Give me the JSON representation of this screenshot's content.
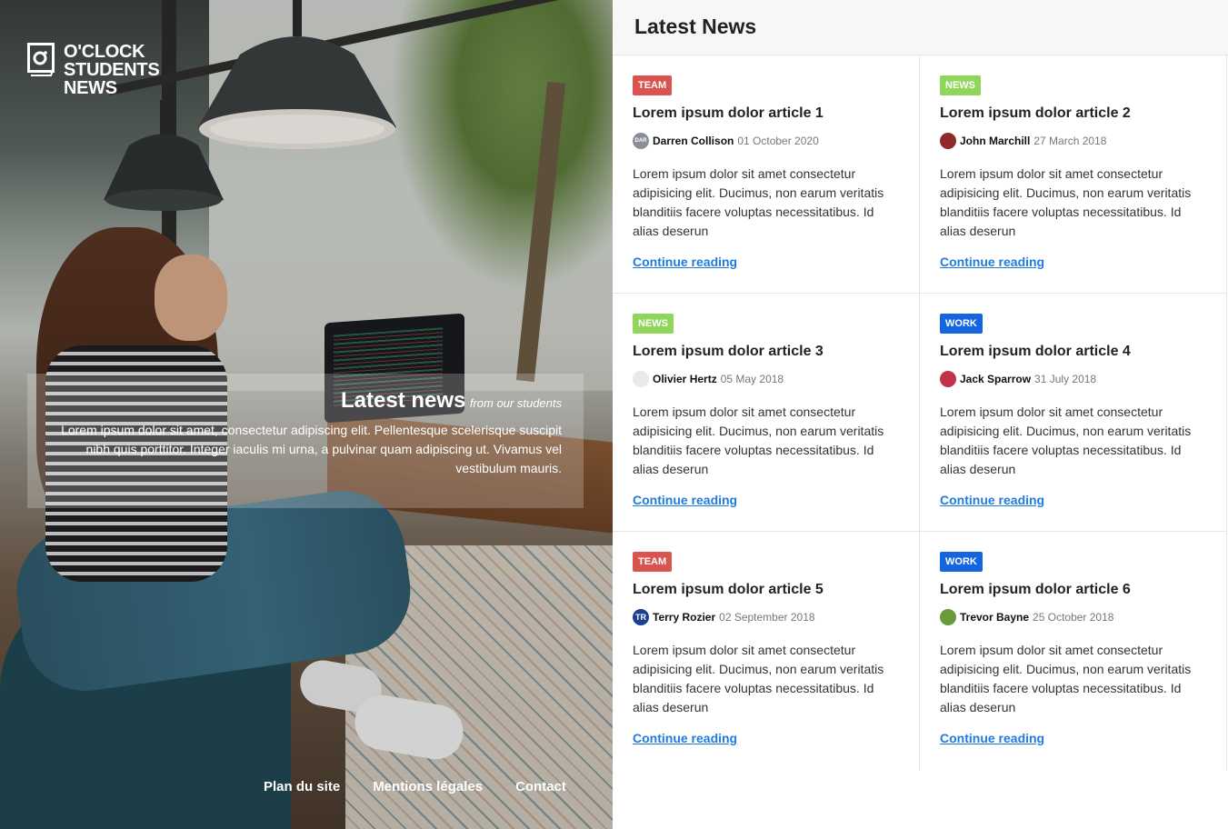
{
  "brand": {
    "lines": [
      "O'CLOCK",
      "STUDENTS",
      "NEWS"
    ]
  },
  "intro": {
    "title": "Latest news",
    "subtitle": "from our students",
    "text": "Lorem ipsum dolor sit amet, consectetur adipiscing elit. Pellentesque scelerisque suscipit nibh quis porttitor. Integer iaculis mi urna, a pulvinar quam adipiscing ut. Vivamus vel vestibulum mauris."
  },
  "footer": {
    "links": [
      "Plan du site",
      "Mentions légales",
      "Contact"
    ]
  },
  "panel": {
    "title": "Latest News"
  },
  "category_colors": {
    "TEAM": "#d9534f",
    "NEWS": "#8fd65a",
    "WORK": "#1565e0"
  },
  "link_color": "#1e7ce0",
  "articles": [
    {
      "category": "TEAM",
      "title": "Lorem ipsum dolor article 1",
      "author": "Darren Collison",
      "date": "01 October 2020",
      "excerpt": "Lorem ipsum dolor sit amet consectetur adipisicing elit. Ducimus, non earum veritatis blanditiis facere voluptas necessitatibus. Id alias deserun",
      "link": "Continue reading",
      "avatar_color": "#8a8f95",
      "avatar_text": "DAR"
    },
    {
      "category": "NEWS",
      "title": "Lorem ipsum dolor article 2",
      "author": "John Marchill",
      "date": "27 March 2018",
      "excerpt": "Lorem ipsum dolor sit amet consectetur adipisicing elit. Ducimus, non earum veritatis blanditiis facere voluptas necessitatibus. Id alias deserun",
      "link": "Continue reading",
      "avatar_color": "#8e2a2a",
      "avatar_text": ""
    },
    {
      "category": "NEWS",
      "title": "Lorem ipsum dolor article 3",
      "author": "Olivier Hertz",
      "date": "05 May 2018",
      "excerpt": "Lorem ipsum dolor sit amet consectetur adipisicing elit. Ducimus, non earum veritatis blanditiis facere voluptas necessitatibus. Id alias deserun",
      "link": "Continue reading",
      "avatar_color": "#e9e9e9",
      "avatar_text": ""
    },
    {
      "category": "WORK",
      "title": "Lorem ipsum dolor article 4",
      "author": "Jack Sparrow",
      "date": "31 July 2018",
      "excerpt": "Lorem ipsum dolor sit amet consectetur adipisicing elit. Ducimus, non earum veritatis blanditiis facere voluptas necessitatibus. Id alias deserun",
      "link": "Continue reading",
      "avatar_color": "#c0334a",
      "avatar_text": ""
    },
    {
      "category": "TEAM",
      "title": "Lorem ipsum dolor article 5",
      "author": "Terry Rozier",
      "date": "02 September 2018",
      "excerpt": "Lorem ipsum dolor sit amet consectetur adipisicing elit. Ducimus, non earum veritatis blanditiis facere voluptas necessitatibus. Id alias deserun",
      "link": "Continue reading",
      "avatar_color": "#1d3f8f",
      "avatar_text": "TR"
    },
    {
      "category": "WORK",
      "title": "Lorem ipsum dolor article 6",
      "author": "Trevor Bayne",
      "date": "25 October 2018",
      "excerpt": "Lorem ipsum dolor sit amet consectetur adipisicing elit. Ducimus, non earum veritatis blanditiis facere voluptas necessitatibus. Id alias deserun",
      "link": "Continue reading",
      "avatar_color": "#6a9b3a",
      "avatar_text": ""
    }
  ]
}
